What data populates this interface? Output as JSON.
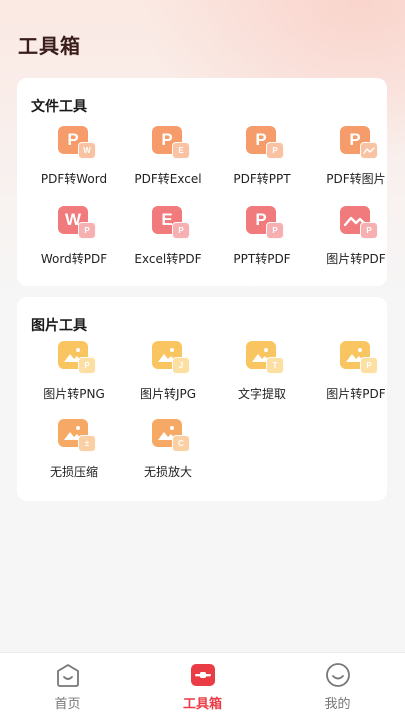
{
  "header": {
    "title": "工具箱"
  },
  "file_tools": {
    "title": "文件工具",
    "items": [
      {
        "label": "PDF转Word",
        "main": "P",
        "sub": "W",
        "color": "orange",
        "icon": "pdf-to-word-icon"
      },
      {
        "label": "PDF转Excel",
        "main": "P",
        "sub": "E",
        "color": "orange",
        "icon": "pdf-to-excel-icon"
      },
      {
        "label": "PDF转PPT",
        "main": "P",
        "sub": "P",
        "color": "orange",
        "icon": "pdf-to-ppt-icon"
      },
      {
        "label": "PDF转图片",
        "main": "P",
        "sub": "image",
        "color": "orange",
        "icon": "pdf-to-image-icon"
      },
      {
        "label": "Word转PDF",
        "main": "W",
        "sub": "P",
        "color": "red",
        "icon": "word-to-pdf-icon"
      },
      {
        "label": "Excel转PDF",
        "main": "E",
        "sub": "P",
        "color": "red",
        "icon": "excel-to-pdf-icon"
      },
      {
        "label": "PPT转PDF",
        "main": "P",
        "sub": "P",
        "color": "red",
        "icon": "ppt-to-pdf-icon"
      },
      {
        "label": "图片转PDF",
        "main": "image",
        "sub": "P",
        "color": "red",
        "icon": "image-to-pdf-icon"
      }
    ]
  },
  "image_tools": {
    "title": "图片工具",
    "items": [
      {
        "label": "图片转PNG",
        "sub": "P",
        "color": "yellow",
        "icon": "image-to-png-icon"
      },
      {
        "label": "图片转JPG",
        "sub": "J",
        "color": "yellow",
        "icon": "image-to-jpg-icon"
      },
      {
        "label": "文字提取",
        "sub": "T",
        "color": "yellow",
        "icon": "text-extract-icon"
      },
      {
        "label": "图片转PDF",
        "sub": "P",
        "color": "yellow",
        "icon": "image-to-pdf-icon"
      },
      {
        "label": "无损压缩",
        "sub": "±",
        "color": "peach",
        "icon": "lossless-compress-icon"
      },
      {
        "label": "无损放大",
        "sub": "C",
        "color": "peach",
        "icon": "lossless-enlarge-icon"
      }
    ]
  },
  "tabbar": {
    "items": [
      {
        "label": "首页",
        "icon": "home-smile-icon",
        "active": false
      },
      {
        "label": "工具箱",
        "icon": "toolbox-icon",
        "active": true
      },
      {
        "label": "我的",
        "icon": "profile-smile-icon",
        "active": false
      }
    ]
  },
  "colors": {
    "accent": "#ea3c45",
    "orange": "#f59c6a",
    "red": "#f07a7c",
    "yellow": "#f9c561",
    "peach": "#f6a965"
  }
}
